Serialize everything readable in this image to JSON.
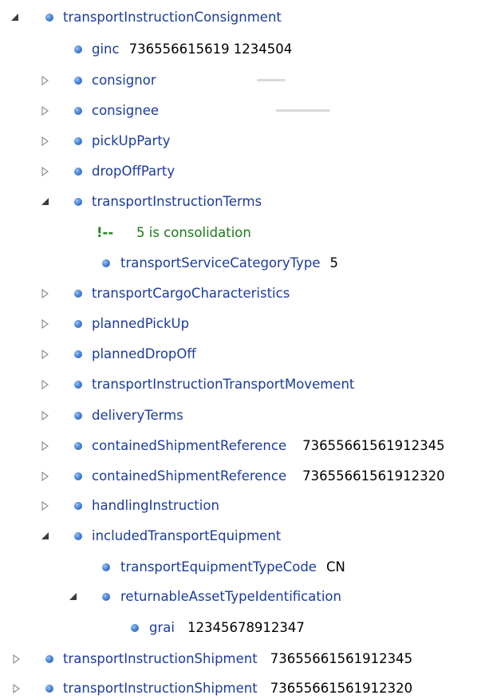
{
  "tree": {
    "root": {
      "label": "transportInstructionConsignment",
      "children": {
        "ginc": {
          "label": "ginc",
          "value": "736556615619 1234504"
        },
        "consignor": {
          "label": "consignor"
        },
        "consignee": {
          "label": "consignee"
        },
        "pickUpParty": {
          "label": "pickUpParty"
        },
        "dropOffParty": {
          "label": "dropOffParty"
        },
        "transportInstructionTerms": {
          "label": "transportInstructionTerms",
          "comment_mark": "!--",
          "comment": "5 is consolidation",
          "serviceCategory": {
            "label": "transportServiceCategoryType",
            "value": "5"
          }
        },
        "transportCargoCharacteristics": {
          "label": "transportCargoCharacteristics"
        },
        "plannedPickUp": {
          "label": "plannedPickUp"
        },
        "plannedDropOff": {
          "label": "plannedDropOff"
        },
        "transportInstructionTransportMovement": {
          "label": "transportInstructionTransportMovement"
        },
        "deliveryTerms": {
          "label": "deliveryTerms"
        },
        "containedShipmentReference1": {
          "label": "containedShipmentReference",
          "value": "73655661561912345"
        },
        "containedShipmentReference2": {
          "label": "containedShipmentReference",
          "value": "73655661561912320"
        },
        "handlingInstruction": {
          "label": "handlingInstruction"
        },
        "includedTransportEquipment": {
          "label": "includedTransportEquipment",
          "equipmentTypeCode": {
            "label": "transportEquipmentTypeCode",
            "value": "CN"
          },
          "returnableAsset": {
            "label": "returnableAssetTypeIdentification",
            "grai": {
              "label": "grai",
              "value": "12345678912347"
            }
          }
        }
      }
    },
    "shipment1": {
      "label": "transportInstructionShipment",
      "value": "73655661561912345"
    },
    "shipment2": {
      "label": "transportInstructionShipment",
      "value": "73655661561912320"
    }
  },
  "colors": {
    "element_label": "#1b3b9c",
    "comment": "#1a7a1a",
    "node_dot": "#3a74cc",
    "toggle": "#6a6a6a"
  },
  "icons": {
    "expanded": "triangle-expanded-icon",
    "collapsed": "triangle-collapsed-icon",
    "node": "element-node-icon"
  }
}
